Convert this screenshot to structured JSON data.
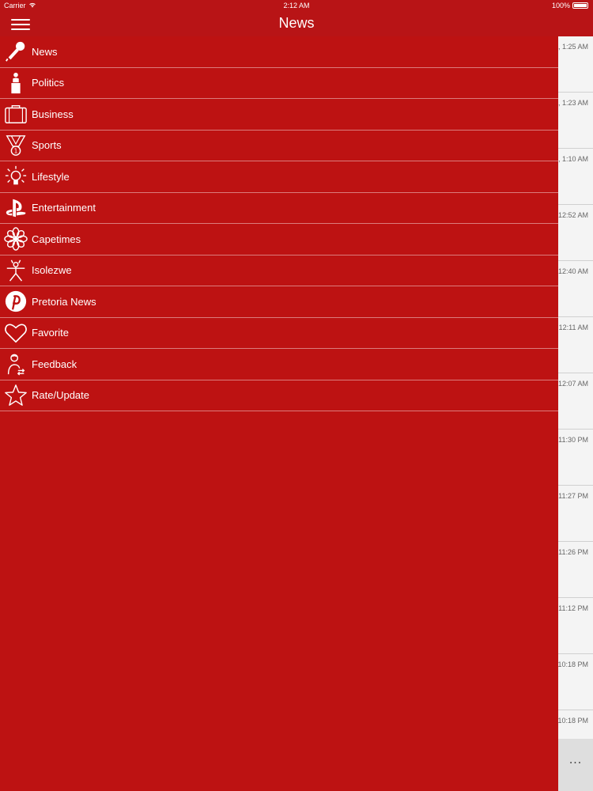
{
  "status_bar": {
    "carrier": "Carrier",
    "time": "2:12 AM",
    "battery": "100%"
  },
  "nav": {
    "title": "News",
    "menu_icon": "hamburger-icon"
  },
  "menu": {
    "items": [
      {
        "label": "News",
        "icon": "microphone-icon"
      },
      {
        "label": "Politics",
        "icon": "podium-speaker-icon"
      },
      {
        "label": "Business",
        "icon": "briefcase-icon"
      },
      {
        "label": "Sports",
        "icon": "medal-icon"
      },
      {
        "label": "Lifestyle",
        "icon": "lightbulb-icon"
      },
      {
        "label": "Entertainment",
        "icon": "playstation-icon"
      },
      {
        "label": "Capetimes",
        "icon": "flower-icon"
      },
      {
        "label": "Isolezwe",
        "icon": "figure-icon"
      },
      {
        "label": "Pretoria News",
        "icon": "pinterest-icon"
      },
      {
        "label": "Favorite",
        "icon": "heart-icon"
      },
      {
        "label": "Feedback",
        "icon": "person-feedback-icon"
      },
      {
        "label": "Rate/Update",
        "icon": "star-icon"
      }
    ]
  },
  "feed": {
    "timestamps": [
      ", 1:25 AM",
      ", 1:23 AM",
      ", 1:10 AM",
      "12:52 AM",
      "12:40 AM",
      "12:11 AM",
      "12:07 AM",
      "11:30 PM",
      "11:27 PM",
      "11:26 PM",
      "11:12 PM",
      "10:18 PM",
      "10:18 PM"
    ],
    "more": "..."
  },
  "colors": {
    "drawer_bg": "#bd1212",
    "navbar_bg": "#b81416",
    "text": "#ffffff"
  }
}
